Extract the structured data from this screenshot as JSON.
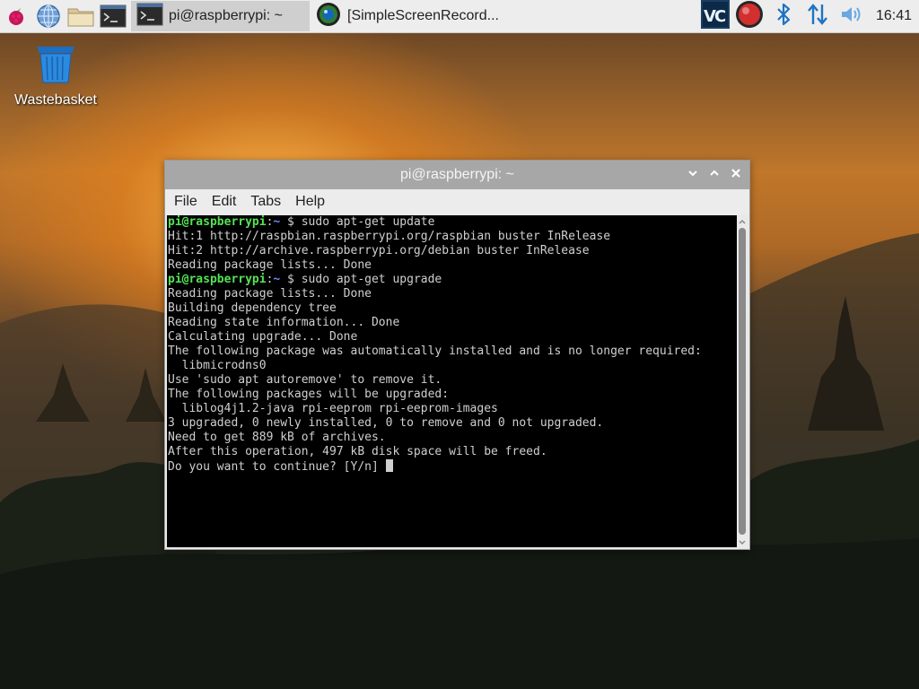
{
  "taskbar": {
    "launchers": [
      {
        "icon": "raspberry-menu-icon"
      },
      {
        "icon": "web-browser-icon"
      },
      {
        "icon": "file-manager-icon"
      },
      {
        "icon": "terminal-icon"
      }
    ],
    "tasks": [
      {
        "label": "pi@raspberrypi: ~",
        "icon": "terminal-icon",
        "active": true
      },
      {
        "label": "[SimpleScreenRecord...",
        "icon": "screen-recorder-icon",
        "active": false
      }
    ],
    "tray": [
      "vnc-icon",
      "record-icon",
      "bluetooth-icon",
      "network-icon",
      "volume-icon"
    ],
    "clock": "16:41"
  },
  "desktop": {
    "icons": [
      {
        "label": "Wastebasket",
        "icon": "wastebasket-icon"
      }
    ]
  },
  "window": {
    "title": "pi@raspberrypi: ~",
    "menus": [
      "File",
      "Edit",
      "Tabs",
      "Help"
    ],
    "prompt_user": "pi@raspberrypi",
    "prompt_path": "~",
    "lines": [
      {
        "type": "prompt",
        "cmd": "sudo apt-get update"
      },
      {
        "type": "out",
        "text": "Hit:1 http://raspbian.raspberrypi.org/raspbian buster InRelease"
      },
      {
        "type": "out",
        "text": "Hit:2 http://archive.raspberrypi.org/debian buster InRelease"
      },
      {
        "type": "out",
        "text": "Reading package lists... Done"
      },
      {
        "type": "prompt",
        "cmd": "sudo apt-get upgrade"
      },
      {
        "type": "out",
        "text": "Reading package lists... Done"
      },
      {
        "type": "out",
        "text": "Building dependency tree"
      },
      {
        "type": "out",
        "text": "Reading state information... Done"
      },
      {
        "type": "out",
        "text": "Calculating upgrade... Done"
      },
      {
        "type": "out",
        "text": "The following package was automatically installed and is no longer required:"
      },
      {
        "type": "out",
        "text": "  libmicrodns0"
      },
      {
        "type": "out",
        "text": "Use 'sudo apt autoremove' to remove it."
      },
      {
        "type": "out",
        "text": "The following packages will be upgraded:"
      },
      {
        "type": "out",
        "text": "  liblog4j1.2-java rpi-eeprom rpi-eeprom-images"
      },
      {
        "type": "out",
        "text": "3 upgraded, 0 newly installed, 0 to remove and 0 not upgraded."
      },
      {
        "type": "out",
        "text": "Need to get 889 kB of archives."
      },
      {
        "type": "out",
        "text": "After this operation, 497 kB disk space will be freed."
      },
      {
        "type": "input",
        "text": "Do you want to continue? [Y/n] "
      }
    ]
  }
}
